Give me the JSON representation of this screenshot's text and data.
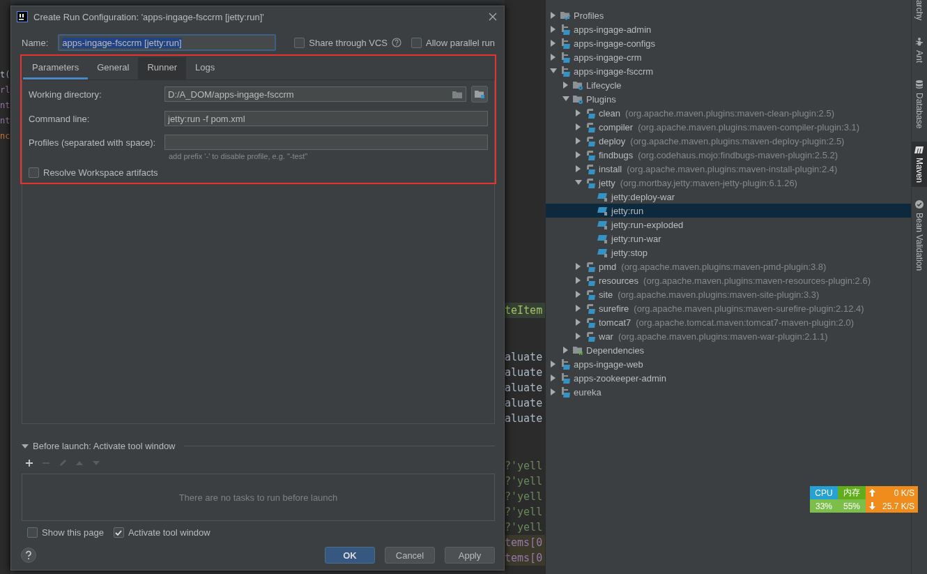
{
  "editor": {
    "left_fragments": [
      {
        "text": "t(",
        "kind": "plain"
      },
      {
        "text": "rl",
        "kind": "field"
      },
      {
        "text": "nt",
        "kind": "field"
      },
      {
        "text": "nt",
        "kind": "field"
      },
      {
        "text": "nc",
        "kind": "keyword"
      }
    ],
    "right_fragments": [
      {
        "text": "teItem",
        "kind": "highlight"
      },
      {
        "text": "aluate",
        "kind": "plain"
      },
      {
        "text": "aluate",
        "kind": "plain"
      },
      {
        "text": "aluate",
        "kind": "plain"
      },
      {
        "text": "aluate",
        "kind": "plain"
      },
      {
        "text": "aluate",
        "kind": "plain"
      },
      {
        "text": "?'yell",
        "kind": "string"
      },
      {
        "text": "?'yell",
        "kind": "string"
      },
      {
        "text": "?'yell",
        "kind": "string"
      },
      {
        "text": "?'yell",
        "kind": "string"
      },
      {
        "text": "?'yell",
        "kind": "string"
      },
      {
        "text": "tems[0",
        "kind": "index"
      },
      {
        "text": "tems[0",
        "kind": "index"
      }
    ]
  },
  "dialog": {
    "title": "Create Run Configuration: 'apps-ingage-fsccrm [jetty:run]'",
    "name_label": "Name:",
    "name_value": "apps-ingage-fsccrm [jetty:run]",
    "options": [
      {
        "label": "Share through VCS",
        "checked": false,
        "help": true
      },
      {
        "label": "Allow parallel run",
        "checked": false,
        "help": false
      }
    ],
    "tabs": [
      {
        "label": "Parameters",
        "selected": true,
        "hovered": false
      },
      {
        "label": "General",
        "selected": false,
        "hovered": false
      },
      {
        "label": "Runner",
        "selected": false,
        "hovered": true
      },
      {
        "label": "Logs",
        "selected": false,
        "hovered": false
      }
    ],
    "fields": [
      {
        "label": "Working directory:",
        "value": "D:/A_DOM/apps-ingage-fsccrm",
        "kind": "directory"
      },
      {
        "label": "Command line:",
        "value": "jetty:run -f pom.xml",
        "kind": "text"
      },
      {
        "label": "Profiles (separated with space):",
        "kind": "text",
        "hint": "add prefix '-' to disable profile, e.g. \"-test\""
      }
    ],
    "resolve": {
      "label": "Resolve Workspace artifacts",
      "checked": false
    },
    "before_launch": {
      "title": "Before launch: Activate tool window",
      "expanded": true,
      "empty_text": "There are no tasks to run before launch"
    },
    "footer_options": [
      {
        "label": "Show this page",
        "checked": false
      },
      {
        "label": "Activate tool window",
        "checked": true
      }
    ],
    "buttons": [
      {
        "label": "OK",
        "kind": "primary"
      },
      {
        "label": "Cancel",
        "kind": "normal"
      },
      {
        "label": "Apply",
        "kind": "normal"
      }
    ]
  },
  "maven_tree": [
    {
      "label": "Profiles",
      "kind": "profiles",
      "expanded": false,
      "selected": false
    },
    {
      "label": "apps-ingage-admin",
      "kind": "module",
      "expanded": false,
      "selected": false
    },
    {
      "label": "apps-ingage-configs",
      "kind": "module",
      "expanded": false,
      "selected": false
    },
    {
      "label": "apps-ingage-crm",
      "kind": "module",
      "expanded": false,
      "selected": false
    },
    {
      "label": "apps-ingage-fsccrm",
      "kind": "module",
      "expanded": true,
      "selected": false,
      "children": [
        {
          "label": "Lifecycle",
          "kind": "folder",
          "expanded": false,
          "selected": false
        },
        {
          "label": "Plugins",
          "kind": "folder",
          "expanded": true,
          "selected": false,
          "children": [
            {
              "label": "clean",
              "detail": "(org.apache.maven.plugins:maven-clean-plugin:2.5)",
              "kind": "plugin",
              "expanded": false,
              "selected": false
            },
            {
              "label": "compiler",
              "detail": "(org.apache.maven.plugins:maven-compiler-plugin:3.1)",
              "kind": "plugin",
              "expanded": false,
              "selected": false
            },
            {
              "label": "deploy",
              "detail": "(org.apache.maven.plugins:maven-deploy-plugin:2.5)",
              "kind": "plugin",
              "expanded": false,
              "selected": false
            },
            {
              "label": "findbugs",
              "detail": "(org.codehaus.mojo:findbugs-maven-plugin:2.5.2)",
              "kind": "plugin",
              "expanded": false,
              "selected": false
            },
            {
              "label": "install",
              "detail": "(org.apache.maven.plugins:maven-install-plugin:2.4)",
              "kind": "plugin",
              "expanded": false,
              "selected": false
            },
            {
              "label": "jetty",
              "detail": "(org.mortbay.jetty:maven-jetty-plugin:6.1.26)",
              "kind": "plugin",
              "expanded": true,
              "selected": false,
              "children": [
                {
                  "label": "jetty:deploy-war",
                  "kind": "goal",
                  "selected": false
                },
                {
                  "label": "jetty:run",
                  "kind": "goal",
                  "selected": true
                },
                {
                  "label": "jetty:run-exploded",
                  "kind": "goal",
                  "selected": false
                },
                {
                  "label": "jetty:run-war",
                  "kind": "goal",
                  "selected": false
                },
                {
                  "label": "jetty:stop",
                  "kind": "goal",
                  "selected": false
                }
              ]
            },
            {
              "label": "pmd",
              "detail": "(org.apache.maven.plugins:maven-pmd-plugin:3.8)",
              "kind": "plugin",
              "expanded": false,
              "selected": false
            },
            {
              "label": "resources",
              "detail": "(org.apache.maven.plugins:maven-resources-plugin:2.6)",
              "kind": "plugin",
              "expanded": false,
              "selected": false
            },
            {
              "label": "site",
              "detail": "(org.apache.maven.plugins:maven-site-plugin:3.3)",
              "kind": "plugin",
              "expanded": false,
              "selected": false
            },
            {
              "label": "surefire",
              "detail": "(org.apache.maven.plugins:maven-surefire-plugin:2.12.4)",
              "kind": "plugin",
              "expanded": false,
              "selected": false
            },
            {
              "label": "tomcat7",
              "detail": "(org.apache.tomcat.maven:tomcat7-maven-plugin:2.0)",
              "kind": "plugin",
              "expanded": false,
              "selected": false
            },
            {
              "label": "war",
              "detail": "(org.apache.maven.plugins:maven-war-plugin:2.1.1)",
              "kind": "plugin",
              "expanded": false,
              "selected": false
            }
          ]
        },
        {
          "label": "Dependencies",
          "kind": "dependencies",
          "expanded": false,
          "selected": false
        }
      ]
    },
    {
      "label": "apps-ingage-web",
      "kind": "module",
      "expanded": false,
      "selected": false
    },
    {
      "label": "apps-zookeeper-admin",
      "kind": "module",
      "expanded": false,
      "selected": false
    },
    {
      "label": "eureka",
      "kind": "module",
      "expanded": false,
      "selected": false
    }
  ],
  "tool_tabs": [
    {
      "label": "archy",
      "kind": "text",
      "selected": false
    },
    {
      "label": "Ant",
      "kind": "ant",
      "selected": false
    },
    {
      "label": "Database",
      "kind": "database",
      "selected": false
    },
    {
      "label": "Maven",
      "kind": "maven",
      "selected": true
    },
    {
      "label": "Bean Validation",
      "kind": "bean",
      "selected": false
    }
  ],
  "monitor": {
    "cpu": {
      "label": "CPU",
      "value": "33%"
    },
    "memory": {
      "label": "内存",
      "value": "55%"
    },
    "upload": "0 K/S",
    "download": "25.7 K/S"
  }
}
